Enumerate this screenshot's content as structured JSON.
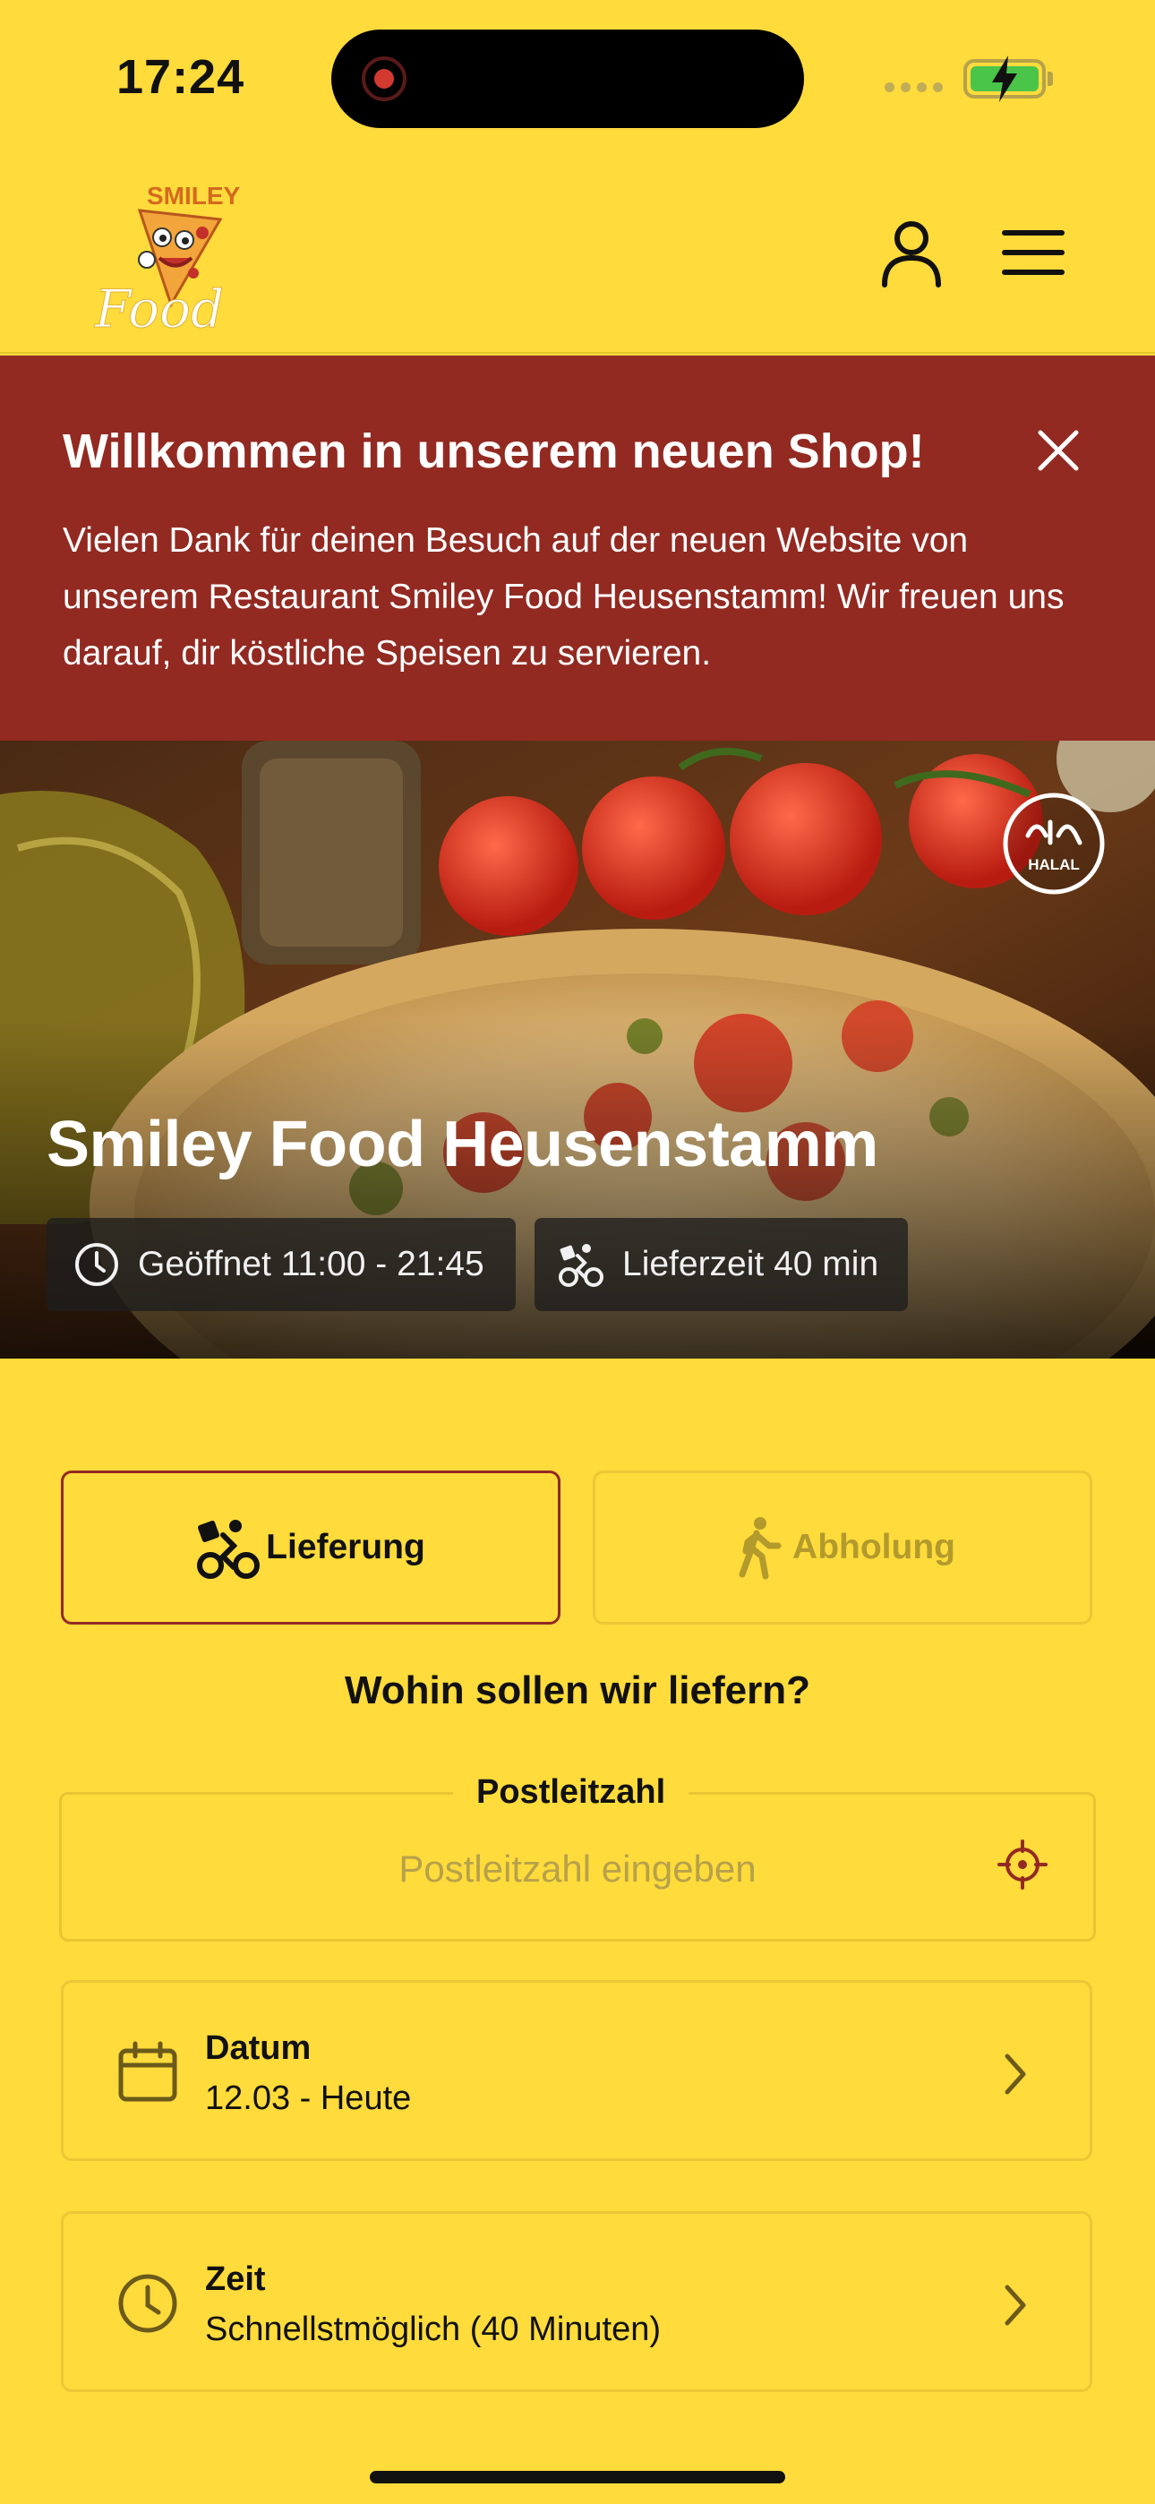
{
  "status": {
    "time": "17:24"
  },
  "header": {
    "logo_alt": "Smiley Food"
  },
  "banner": {
    "title": "Willkommen in unserem neuen Shop!",
    "text": "Vielen Dank für deinen Besuch auf der neuen Website von unserem Restaurant Smiley Food Heusenstamm! Wir freuen uns darauf, dir köstliche Speisen zu servieren."
  },
  "hero": {
    "name": "Smiley Food Heusenstamm",
    "opening": "Geöffnet 11:00 - 21:45",
    "delivery_time": "Lieferzeit 40 min",
    "halal_label": "HALAL"
  },
  "mode": {
    "delivery": "Lieferung",
    "pickup": "Abholung",
    "selected": "delivery"
  },
  "question": "Wohin sollen wir liefern?",
  "postal": {
    "label": "Postleitzahl",
    "placeholder": "Postleitzahl eingeben",
    "value": ""
  },
  "date": {
    "title": "Datum",
    "value": "12.03 - Heute"
  },
  "time": {
    "title": "Zeit",
    "value": "Schnellstmöglich (40 Minuten)"
  },
  "colors": {
    "background": "#FFDB3B",
    "banner": "#922A22",
    "accent": "#922A22"
  }
}
